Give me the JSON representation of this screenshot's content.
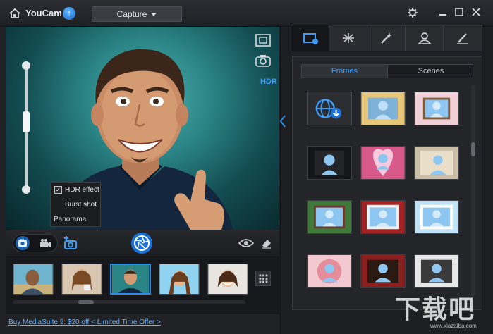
{
  "titlebar": {
    "app_title": "YouCam",
    "mode_select": "Capture",
    "icons": {
      "logo": "home-icon",
      "update": "upload-arrow-icon",
      "settings": "gear-icon",
      "minimize": "minimize-icon",
      "maximize": "maximize-icon",
      "close": "close-icon"
    }
  },
  "preview": {
    "hdr_label": "HDR",
    "zoom_level": 0.62,
    "menu": {
      "items": [
        {
          "label": "HDR effect",
          "checked": true
        },
        {
          "label": "Burst shot",
          "checked": false
        },
        {
          "label": "Panorama",
          "checked": false
        }
      ]
    }
  },
  "toolbar": {
    "icons": [
      "camera-icon",
      "video-camera-icon",
      "selfie-camera-icon",
      "shutter-icon",
      "eye-icon",
      "eraser-icon"
    ]
  },
  "thumbnails": {
    "count": 5,
    "selected_index": 2
  },
  "promo": {
    "text": "Buy  MediaSuite 9: $20 off  < Limited Time Offer >"
  },
  "effects": {
    "tabs": [
      "frames-tab-icon",
      "particle-effects-icon",
      "magic-wand-icon",
      "avatar-icon",
      "brush-icon"
    ],
    "active_tab": 0,
    "segment": {
      "frames": "Frames",
      "scenes": "Scenes",
      "active": "frames"
    },
    "frames_count": 12
  },
  "watermark": {
    "big": "下载吧",
    "small": "www.xiazaiba.com"
  },
  "colors": {
    "accent": "#2f8be6",
    "highlight": "#3d9cf5",
    "background": "#1b1c1f"
  }
}
